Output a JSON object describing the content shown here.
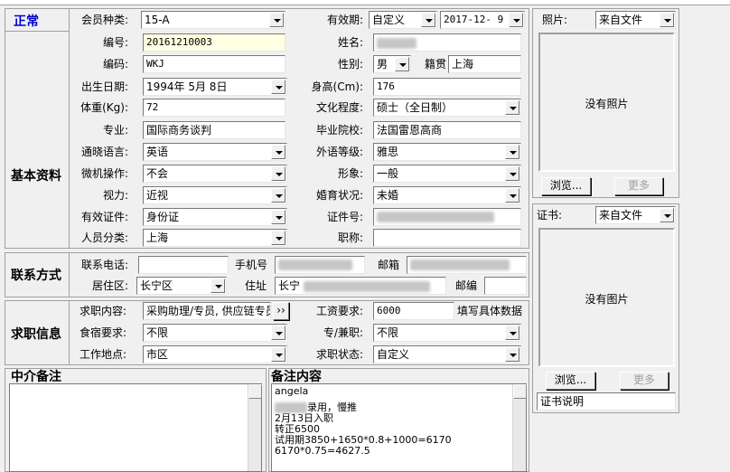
{
  "topbar": {
    "text": ""
  },
  "status": {
    "label": "正常",
    "color": "#0000cc"
  },
  "member": {
    "type_label": "会员种类:",
    "type_value": "15-A",
    "validity_label": "有效期:",
    "validity_mode": "自定义",
    "validity_date": "2017-12- 9"
  },
  "basic": {
    "section_title": "基本资料",
    "id_label": "编号:",
    "id_value": "20161210003",
    "name_label": "姓名:",
    "code_label": "编码:",
    "code_value": "WKJ",
    "gender_label": "性别:",
    "gender_value": "男",
    "native_label": "籍贯",
    "native_value": "上海",
    "birth_label": "出生日期:",
    "birth_value": "1994年 5月 8日",
    "height_label": "身高(Cm):",
    "height_value": "176",
    "weight_label": "体重(Kg):",
    "weight_value": "72",
    "education_label": "文化程度:",
    "education_value": "硕士（全日制）",
    "major_label": "专业:",
    "major_value": "国际商务谈判",
    "school_label": "毕业院校:",
    "school_value": "法国雷恩高商",
    "language_label": "通晓语言:",
    "language_value": "英语",
    "lang_level_label": "外语等级:",
    "lang_level_value": "雅思",
    "computer_label": "微机操作:",
    "computer_value": "不会",
    "image_label": "形象:",
    "image_value": "一般",
    "vision_label": "视力:",
    "vision_value": "近视",
    "marital_label": "婚育状况:",
    "marital_value": "未婚",
    "idtype_label": "有效证件:",
    "idtype_value": "身份证",
    "idno_label": "证件号:",
    "category_label": "人员分类:",
    "category_value": "上海",
    "title_label": "职称:",
    "title_value": ""
  },
  "contact": {
    "section_title": "联系方式",
    "phone_label": "联系电话:",
    "phone_value": "",
    "mobile_label": "手机号",
    "email_label": "邮箱",
    "district_label": "居住区:",
    "district_value": "长宁区",
    "address_label": "住址",
    "address_prefix": "长宁",
    "postcode_label": "邮编",
    "postcode_value": ""
  },
  "job": {
    "section_title": "求职信息",
    "content_label": "求职内容:",
    "content_value": "采购助理/专员, 供应链专员",
    "more_button": "››",
    "salary_label": "工资要求:",
    "salary_value": "6000",
    "salary_hint": "填写具体数据",
    "lodging_label": "食宿要求:",
    "lodging_value": "不限",
    "fulltime_label": "专/兼职:",
    "fulltime_value": "不限",
    "location_label": "工作地点:",
    "location_value": "市区",
    "jobstatus_label": "求职状态:",
    "jobstatus_value": "自定义"
  },
  "agency_note": {
    "title": "中介备注",
    "text": ""
  },
  "remarks": {
    "title": "备注内容",
    "lines": [
      "angela",
      "录用，慢推",
      "2月13日入职",
      "转正6500",
      "试用期3850+1650*0.8+1000=6170",
      "6170*0.75=4627.5"
    ]
  },
  "photo": {
    "label": "照片:",
    "source": "来自文件",
    "placeholder": "没有照片",
    "browse": "浏览...",
    "more": "更多"
  },
  "certificate": {
    "label": "证书:",
    "source": "来自文件",
    "placeholder": "没有图片",
    "browse": "浏览...",
    "more": "更多",
    "desc_value": "证书说明"
  }
}
